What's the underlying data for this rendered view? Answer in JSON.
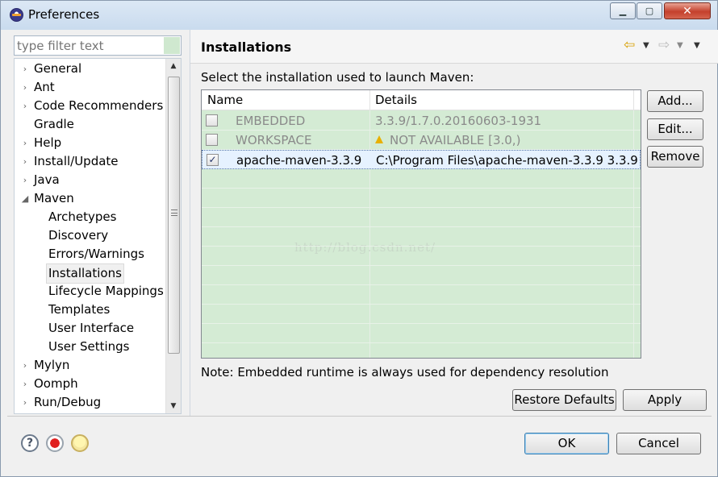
{
  "window": {
    "title": "Preferences"
  },
  "filter": {
    "placeholder": "type filter text"
  },
  "tree": {
    "items": [
      {
        "label": "General",
        "level": 0,
        "arrow": "›"
      },
      {
        "label": "Ant",
        "level": 0,
        "arrow": "›"
      },
      {
        "label": "Code Recommenders",
        "level": 0,
        "arrow": "›"
      },
      {
        "label": "Gradle",
        "level": 0,
        "arrow": ""
      },
      {
        "label": "Help",
        "level": 0,
        "arrow": "›"
      },
      {
        "label": "Install/Update",
        "level": 0,
        "arrow": "›"
      },
      {
        "label": "Java",
        "level": 0,
        "arrow": "›"
      },
      {
        "label": "Maven",
        "level": 0,
        "arrow": "◢"
      },
      {
        "label": "Archetypes",
        "level": 1,
        "arrow": ""
      },
      {
        "label": "Discovery",
        "level": 1,
        "arrow": ""
      },
      {
        "label": "Errors/Warnings",
        "level": 1,
        "arrow": ""
      },
      {
        "label": "Installations",
        "level": 1,
        "arrow": "",
        "selected": true
      },
      {
        "label": "Lifecycle Mappings",
        "level": 1,
        "arrow": ""
      },
      {
        "label": "Templates",
        "level": 1,
        "arrow": ""
      },
      {
        "label": "User Interface",
        "level": 1,
        "arrow": ""
      },
      {
        "label": "User Settings",
        "level": 1,
        "arrow": ""
      },
      {
        "label": "Mylyn",
        "level": 0,
        "arrow": "›"
      },
      {
        "label": "Oomph",
        "level": 0,
        "arrow": "›"
      },
      {
        "label": "Run/Debug",
        "level": 0,
        "arrow": "›"
      }
    ]
  },
  "page": {
    "title": "Installations",
    "instructions": "Select the installation used to launch Maven:",
    "note": "Note: Embedded runtime is always used for dependency resolution",
    "watermark": "http://blog.csdn.net/"
  },
  "table": {
    "columns": [
      "Name",
      "Details"
    ],
    "rows": [
      {
        "name": "EMBEDDED",
        "details": "3.3.9/1.7.0.20160603-1931",
        "checked": false,
        "disabled": true,
        "warning": false
      },
      {
        "name": "WORKSPACE",
        "details": "NOT AVAILABLE [3.0,)",
        "checked": false,
        "disabled": true,
        "warning": true
      },
      {
        "name": "apache-maven-3.3.9",
        "details": "C:\\Program Files\\apache-maven-3.3.9 3.3.9",
        "checked": true,
        "disabled": false,
        "warning": false,
        "selected": true
      }
    ]
  },
  "buttons": {
    "add": "Add...",
    "edit": "Edit...",
    "remove": "Remove",
    "restore_defaults": "Restore Defaults",
    "apply": "Apply",
    "ok": "OK",
    "cancel": "Cancel"
  },
  "titlebar_buttons": {
    "minimize": "▁",
    "maximize": "▢",
    "close": "✕"
  },
  "checkmark": "✓",
  "icons": {
    "nav_back": "⇦",
    "nav_forward": "⇨",
    "dropdown": "▼",
    "help": "?"
  }
}
